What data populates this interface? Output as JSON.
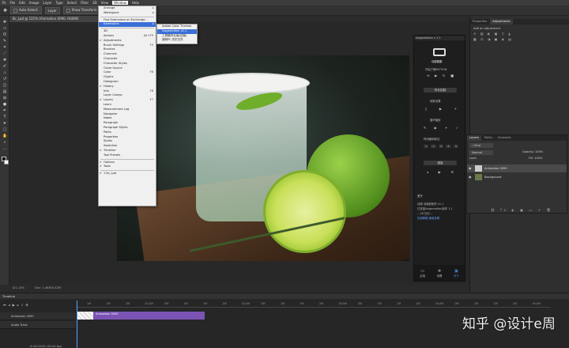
{
  "menubar": {
    "items": [
      "Ps",
      "File",
      "Edit",
      "Image",
      "Layer",
      "Type",
      "Select",
      "Filter",
      "3D",
      "View",
      "Window",
      "Help"
    ],
    "active_index": 10
  },
  "optbar": {
    "auto_select_label": "Auto-Select:",
    "auto_select_value": "Layer",
    "show_transform_label": "Show Transform Controls"
  },
  "document": {
    "tab_title": "8c_Lpd @ 121% (Animation 0090, RGB/8)"
  },
  "window_menu": {
    "items": [
      {
        "label": "Arrange",
        "arrow": true
      },
      {
        "label": "Workspace",
        "arrow": true
      },
      {
        "sep": true
      },
      {
        "label": "Find Extensions on Exchange..."
      },
      {
        "label": "Extensions",
        "arrow": true,
        "highlight": true
      },
      {
        "sep": true
      },
      {
        "label": "3D"
      },
      {
        "label": "Actions",
        "shortcut": "Alt+F9"
      },
      {
        "label": "Adjustments",
        "checked": true
      },
      {
        "label": "Brush Settings",
        "shortcut": "F5"
      },
      {
        "label": "Brushes"
      },
      {
        "label": "Channels"
      },
      {
        "label": "Character"
      },
      {
        "label": "Character Styles"
      },
      {
        "label": "Clone Source"
      },
      {
        "label": "Color",
        "shortcut": "F6"
      },
      {
        "label": "Glyphs"
      },
      {
        "label": "Histogram"
      },
      {
        "label": "History",
        "checked": true
      },
      {
        "label": "Info",
        "shortcut": "F8"
      },
      {
        "label": "Layer Comps"
      },
      {
        "label": "Layers",
        "checked": true,
        "shortcut": "F7"
      },
      {
        "label": "Learn"
      },
      {
        "label": "Measurement Log"
      },
      {
        "label": "Navigator"
      },
      {
        "label": "Notes"
      },
      {
        "label": "Paragraph"
      },
      {
        "label": "Paragraph Styles"
      },
      {
        "label": "Paths"
      },
      {
        "label": "Properties"
      },
      {
        "label": "Styles"
      },
      {
        "label": "Swatches"
      },
      {
        "label": "Timeline",
        "checked": true
      },
      {
        "label": "Tool Presets"
      },
      {
        "sep": true
      },
      {
        "label": "Options",
        "checked": true
      },
      {
        "label": "Tools",
        "checked": true
      },
      {
        "sep": true
      },
      {
        "label": "1 8c_Lpd",
        "checked": true
      }
    ]
  },
  "extensions_menu": {
    "items": [
      {
        "label": "Adobe Color Themes"
      },
      {
        "label": "Ivogamotion v1.1",
        "highlight": true
      },
      {
        "label": "工具箱专业版(旧版)"
      },
      {
        "label": "速修PL 历史文件"
      }
    ]
  },
  "plugin": {
    "header": "Ivogamotion v 1.1",
    "brand": "动感雅集",
    "line1": "开始了解MOTION",
    "section_time": "时长控制",
    "section_frames": "帧数设置",
    "section_loop": "循环播放",
    "section_ease": "时间缓和算法",
    "section_render": "渲染",
    "nums": [
      "1",
      "2",
      "3",
      "4",
      "5"
    ],
    "about_title": "关于",
    "about_lines": [
      "动感 动画帧制作 v1.1",
      "已安装Ivogamotion版本 1.1",
      "-- 18 日记 --",
      "在线教程    使用说明"
    ],
    "footer_tabs": [
      "应用",
      "设置",
      "关于"
    ]
  },
  "right_panels": {
    "top_tabs": [
      "Properties",
      "Adjustments"
    ],
    "add_adjustment": "Add an adjustment"
  },
  "layers": {
    "tabs": [
      "Layers",
      "Paths",
      "Channels"
    ],
    "kind": "Kind",
    "blend": "Normal",
    "opacity_label": "Opacity:",
    "opacity_value": "100%",
    "lock_label": "Lock:",
    "fill_label": "Fill:",
    "fill_value": "100%",
    "rows": [
      {
        "name": "Animation 0090",
        "selected": true
      },
      {
        "name": "Background",
        "selected": false
      }
    ]
  },
  "status": {
    "zoom": "121.13%",
    "doc": "Doc: 1.48M/3.42M"
  },
  "timeline": {
    "title": "Timeline",
    "tracks": [
      "Animation 0090",
      "Audio Track"
    ],
    "ticks": [
      "10f",
      "15f",
      "20f",
      "01:00f",
      "05f",
      "10f",
      "15f",
      "20f",
      "02:00f",
      "05f",
      "10f",
      "15f",
      "20f",
      "03:00f",
      "05f",
      "10f",
      "15f",
      "20f",
      "04:00f",
      "05f",
      "10f",
      "15f",
      "20f",
      "05:00f"
    ],
    "clip_label": "Animation 0090",
    "time": "0:00:00:00",
    "fps": "(30.00 fps)"
  },
  "watermark": "知乎 @设计e周"
}
